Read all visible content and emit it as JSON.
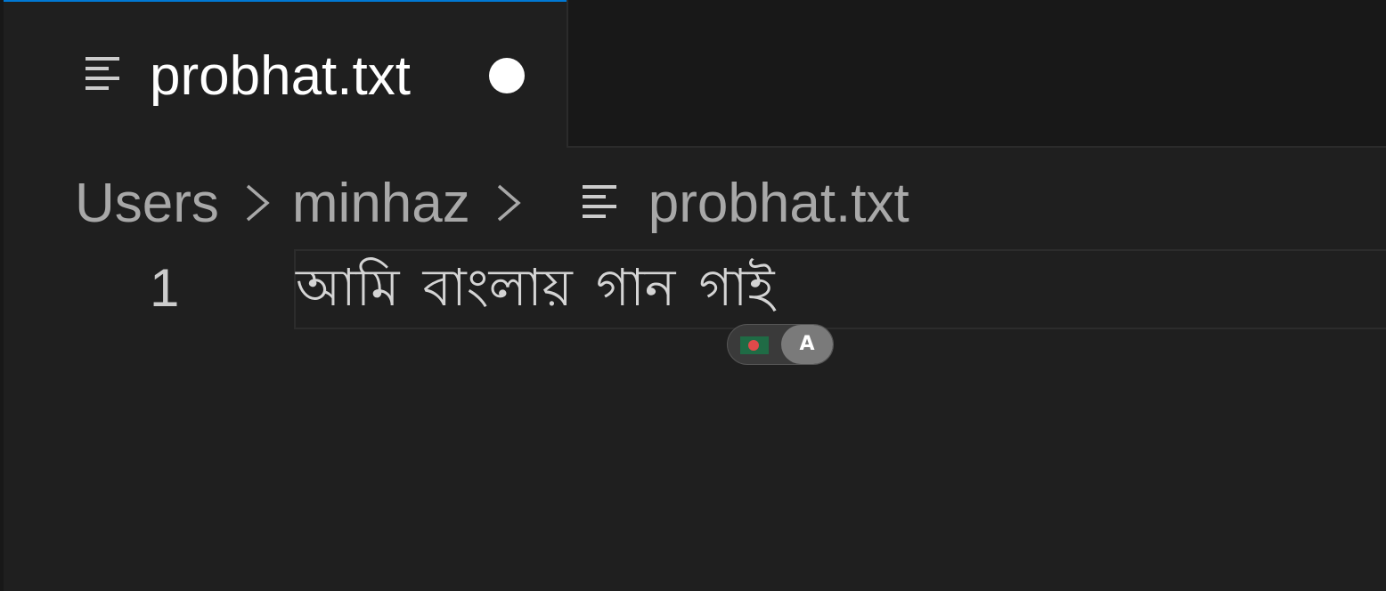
{
  "tab": {
    "title": "probhat.txt",
    "icon": "file-text-icon",
    "dirty": true
  },
  "breadcrumb": {
    "items": [
      "Users",
      "minhaz"
    ],
    "separator_icon": "chevron-right-icon",
    "file_icon": "file-text-icon",
    "file": "probhat.txt"
  },
  "editor": {
    "lines": [
      {
        "number": "1",
        "text": "আমি বাংলায় গান গাই"
      }
    ]
  },
  "input_method": {
    "flag": "bangladesh-flag-icon",
    "indicator": "A"
  },
  "colors": {
    "accent": "#0078d4",
    "background": "#1f1f1f",
    "tabbar_background": "#181818",
    "text": "#d4d4d4",
    "breadcrumb_text": "#a8a8a8"
  }
}
